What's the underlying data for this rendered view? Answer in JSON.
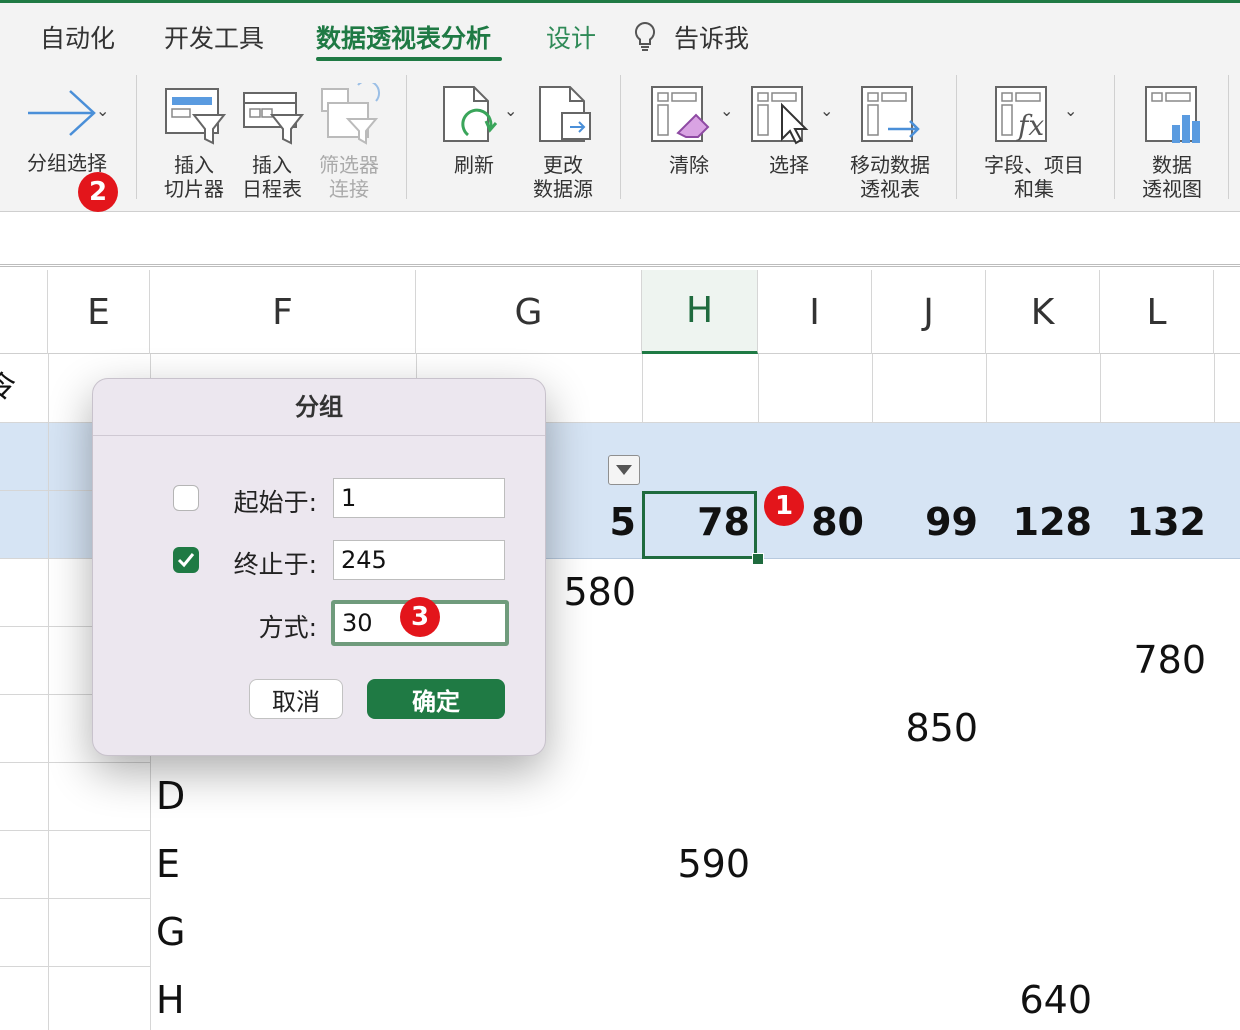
{
  "ribbon": {
    "tabs": [
      {
        "label": "自动化"
      },
      {
        "label": "开发工具"
      },
      {
        "label": "数据透视表分析",
        "active": true
      },
      {
        "label": "设计"
      },
      {
        "label": "告诉我"
      }
    ],
    "buttons": {
      "group_selection": "分组选择",
      "insert_slicer": [
        "插入",
        "切片器"
      ],
      "insert_timeline": [
        "插入",
        "日程表"
      ],
      "filter_connections": [
        "筛选器",
        "连接"
      ],
      "refresh": "刷新",
      "change_source": [
        "更改",
        "数据源"
      ],
      "clear": "清除",
      "select": "选择",
      "move_pivot": [
        "移动数据",
        "透视表"
      ],
      "fields_items": [
        "字段、项目",
        "和集"
      ],
      "pivot_chart": [
        "数据",
        "透视图"
      ]
    }
  },
  "columns": [
    "E",
    "F",
    "G",
    "H",
    "I",
    "J",
    "K",
    "L"
  ],
  "selected_column": "H",
  "pivot_header_values": [
    "5",
    "78",
    "80",
    "99",
    "128",
    "132"
  ],
  "row_labels": [
    "D",
    "E",
    "G",
    "H"
  ],
  "cell_values": {
    "g_580": "580",
    "l_780": "780",
    "j_850": "850",
    "h_590": "590",
    "k_640": "640"
  },
  "badges": [
    "1",
    "2",
    "3"
  ],
  "dialog": {
    "title": "分组",
    "start_label": "起始于:",
    "start_value": "1",
    "start_checked": false,
    "end_label": "终止于:",
    "end_value": "245",
    "end_checked": true,
    "by_label": "方式:",
    "by_value": "30",
    "cancel": "取消",
    "ok": "确定"
  },
  "colors": {
    "accent": "#1f7a44",
    "badge": "#e3151b",
    "pivot_band": "#d6e4f4"
  }
}
